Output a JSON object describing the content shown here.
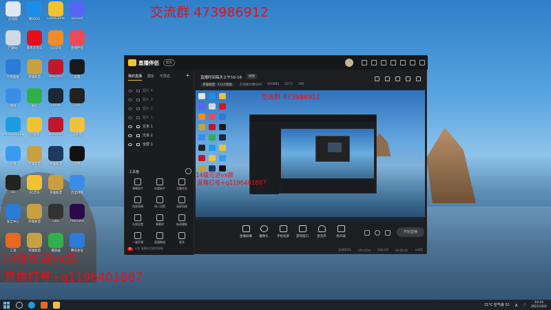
{
  "overlay": {
    "top_group": "交流群 473986912",
    "bottom_line1": "14级可进vx群",
    "bottom_line2": "直播打号+q1196401887"
  },
  "desktop_icons": [
    {
      "label": "此电脑",
      "color": "#dfe8f2"
    },
    {
      "label": "腾讯QQ",
      "color": "#1b8fe8"
    },
    {
      "label": "GoodGame",
      "color": "#f2c230"
    },
    {
      "label": "Discord",
      "color": "#5865f2"
    },
    {
      "label": "回收站",
      "color": "#cfd9e4"
    },
    {
      "label": "网易云音乐",
      "color": "#e3101a"
    },
    {
      "label": "QQ游戏",
      "color": "#f28c28"
    },
    {
      "label": "直播伴侣",
      "color": "#e84c5a"
    },
    {
      "label": "控制面板",
      "color": "#2c7bd6"
    },
    {
      "label": "英雄联盟",
      "color": "#c8a040"
    },
    {
      "label": "WeGame",
      "color": "#c0182b"
    },
    {
      "label": "设置",
      "color": "#1a1a1a"
    },
    {
      "label": "网络",
      "color": "#3a8ee8"
    },
    {
      "label": "微信",
      "color": "#30b04a"
    },
    {
      "label": "Steam",
      "color": "#1b2838"
    },
    {
      "label": "Epic",
      "color": "#222"
    },
    {
      "label": "Microsoft Edge",
      "color": "#1c9ce0"
    },
    {
      "label": "YY语音",
      "color": "#f2c230"
    },
    {
      "label": "WeGame",
      "color": "#c0182b"
    },
    {
      "label": "文件夹",
      "color": "#f2c040"
    },
    {
      "label": "迅雷",
      "color": "#3a9af0"
    },
    {
      "label": "英雄联盟",
      "color": "#c8a040"
    },
    {
      "label": "英雄联盟",
      "color": "#1e3a5f"
    },
    {
      "label": "剪映",
      "color": "#111"
    },
    {
      "label": "GG",
      "color": "#222"
    },
    {
      "label": "QQ音乐",
      "color": "#f2c230"
    },
    {
      "label": "英雄联盟",
      "color": "#c8a040"
    },
    {
      "label": "百度网盘",
      "color": "#3a8ee8"
    },
    {
      "label": "安全中心",
      "color": "#2c7bd6"
    },
    {
      "label": "英雄联盟",
      "color": "#c8a040"
    },
    {
      "label": "OBS",
      "color": "#333"
    },
    {
      "label": "Premiere",
      "color": "#2a0a4a"
    },
    {
      "label": "工具",
      "color": "#e86a20"
    },
    {
      "label": "英雄联盟",
      "color": "#c8a040"
    },
    {
      "label": "播放器",
      "color": "#30b04a"
    },
    {
      "label": "腾讯会议",
      "color": "#2c7bd6"
    }
  ],
  "app": {
    "title": "直播伴侣",
    "version": "官方",
    "tabs": [
      "我的直播",
      "圈友",
      "可改名"
    ],
    "scenes": [
      {
        "label": "图片 4",
        "on": false
      },
      {
        "label": "图片 3",
        "on": false
      },
      {
        "label": "图片 2",
        "on": false
      },
      {
        "label": "图片 1",
        "on": false
      },
      {
        "label": "文本 1",
        "on": true
      },
      {
        "label": "文本 2",
        "on": true
      },
      {
        "label": "全屏 1",
        "on": true
      }
    ],
    "tools_header": "工具箱",
    "tools": [
      "弹幕助手",
      "房管助手",
      "主播任务",
      "投屏直播",
      "录入设置",
      "录屏回放",
      "礼物设置",
      "弹幕库",
      "新闻播报",
      "一键开播",
      "直播数据",
      "更多"
    ],
    "notice_tag": "热",
    "notice_text": "公告 直播伴侣使用帮助",
    "room_title": "直播时间每天上午10-18",
    "room_edit": "修改",
    "meta_category": "英雄联盟 · 1111等级",
    "meta_viewers": "在线观众数DAO",
    "meta_score": "826885",
    "meta_hot": "2273",
    "meta_fans": "180",
    "preview_group": "交流群 473986912",
    "preview_line1": "14级可进vx群",
    "preview_line2": "直播打号+q1196401887",
    "controls": [
      "直播屏幕",
      "摄像头",
      "手机投屏",
      "游戏窗口",
      "麦克风",
      "扬声器"
    ],
    "go_live": "开始直播",
    "status": [
      "丢帧率0%",
      "CPU 45%",
      "内存占用",
      "00:00:00",
      "卡顿率"
    ]
  },
  "taskbar": {
    "weather": "21°C 空气良 51",
    "time": "10:16",
    "date": "2021/10/1",
    "icons": [
      "start",
      "search",
      "edge",
      "goodgame",
      "file"
    ]
  }
}
